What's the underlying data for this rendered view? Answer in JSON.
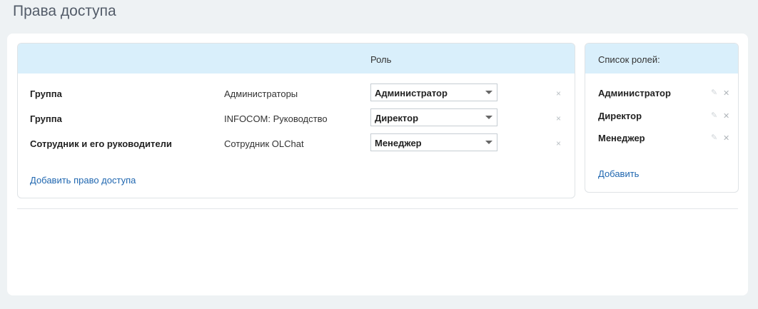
{
  "page": {
    "title": "Права доступа"
  },
  "access": {
    "role_column": "Роль",
    "rows": [
      {
        "type": "Группа",
        "subject": "Администраторы",
        "role": "Администратор"
      },
      {
        "type": "Группа",
        "subject": "INFOCOM: Руководство",
        "role": "Директор"
      },
      {
        "type": "Сотрудник и его руководители",
        "subject": "Сотрудник OLChat",
        "role": "Менеджер"
      }
    ],
    "remove_glyph": "×",
    "add_link": "Добавить право доступа"
  },
  "roles": {
    "title": "Список ролей:",
    "items": [
      {
        "name": "Администратор"
      },
      {
        "name": "Директор"
      },
      {
        "name": "Менеджер"
      }
    ],
    "edit_glyph": "✎",
    "remove_glyph": "✕",
    "add_link": "Добавить"
  },
  "colors": {
    "header_bg": "#d9effb",
    "link": "#2067b0",
    "page_bg": "#eef2f4"
  },
  "icons": {
    "remove": "close-icon",
    "edit": "pencil-icon",
    "select_arrow": "chevron-down-icon"
  }
}
